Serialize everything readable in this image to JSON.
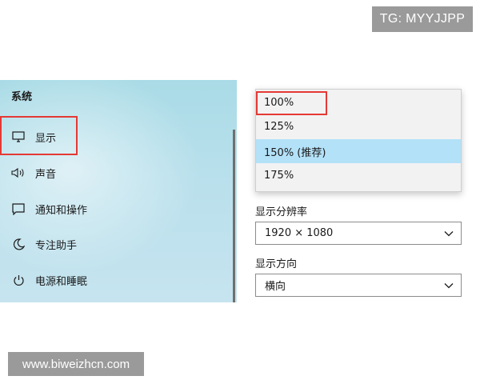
{
  "watermarks": {
    "top_right": "TG: MYYJJPP",
    "bottom_left": "www.biweizhcn.com"
  },
  "sidebar": {
    "section_title": "系统",
    "items": [
      {
        "label": "显示",
        "icon": "monitor-icon"
      },
      {
        "label": "声音",
        "icon": "speaker-icon"
      },
      {
        "label": "通知和操作",
        "icon": "notification-icon"
      },
      {
        "label": "专注助手",
        "icon": "moon-icon"
      },
      {
        "label": "电源和睡眠",
        "icon": "power-icon"
      }
    ]
  },
  "scale_dropdown": {
    "options": [
      "100%",
      "125%",
      "150% (推荐)",
      "175%"
    ],
    "selected_index": 2
  },
  "resolution": {
    "label": "显示分辨率",
    "value": "1920 × 1080"
  },
  "orientation": {
    "label": "显示方向",
    "value": "横向"
  },
  "colors": {
    "highlight_box": "#e53935",
    "selected_option": "#b3e1f8",
    "panel_background": "#b9e0ec"
  }
}
